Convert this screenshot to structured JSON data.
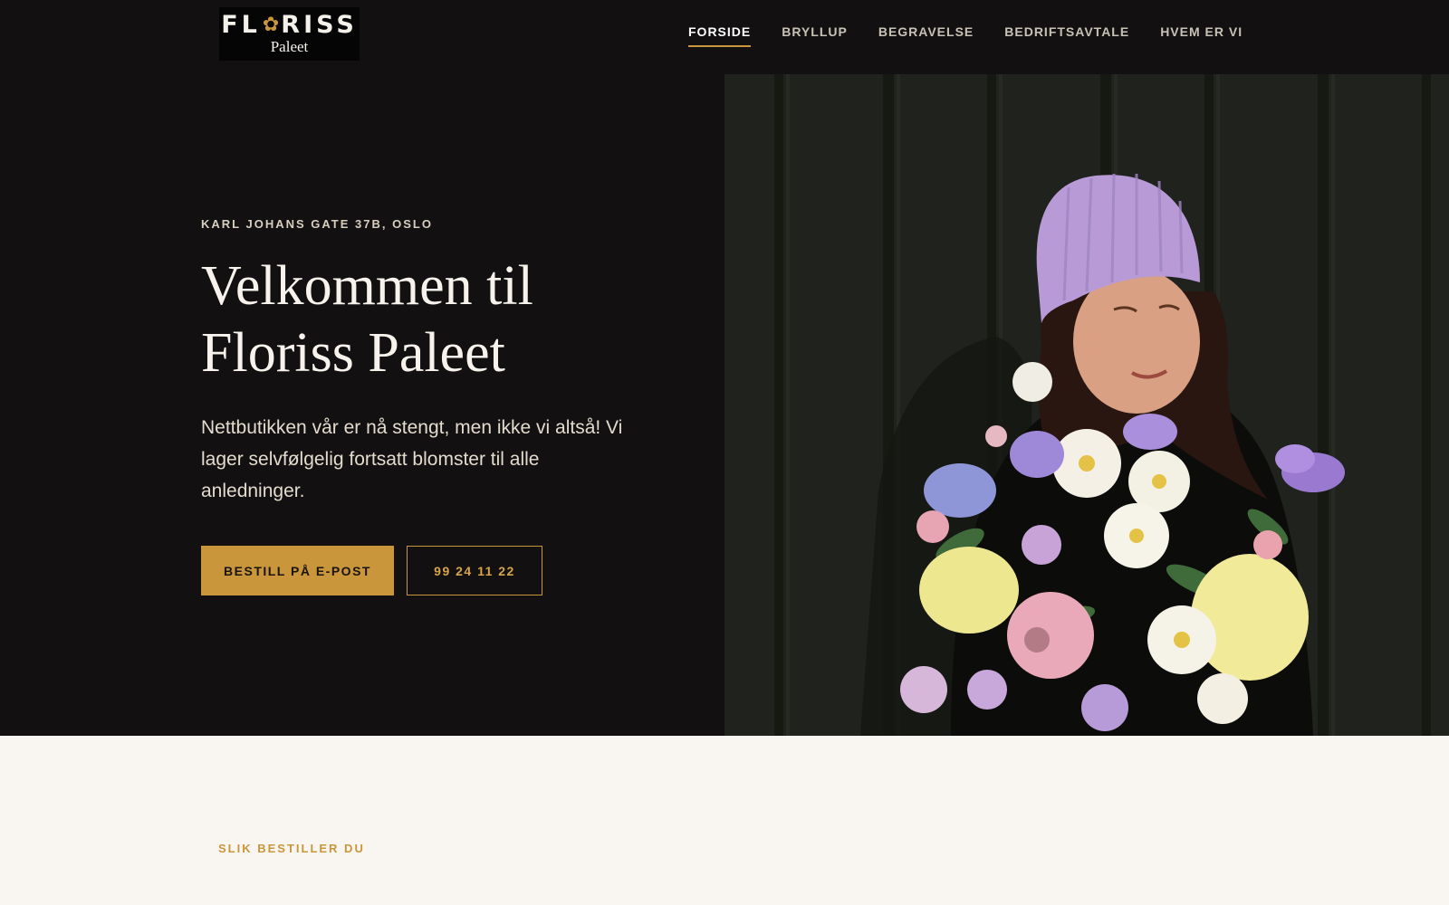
{
  "logo": {
    "main_left": "FL",
    "main_right": "RISS",
    "sub": "Paleet"
  },
  "nav": {
    "items": [
      {
        "label": "FORSIDE",
        "active": true
      },
      {
        "label": "BRYLLUP",
        "active": false
      },
      {
        "label": "BEGRAVELSE",
        "active": false
      },
      {
        "label": "BEDRIFTSAVTALE",
        "active": false
      },
      {
        "label": "HVEM ER VI",
        "active": false
      }
    ]
  },
  "hero": {
    "address": "KARL JOHANS GATE 37B, OSLO",
    "title_line1": "Velkommen til",
    "title_line2": "Floriss Paleet",
    "text": "Nettbutikken vår er nå stengt, men ikke vi altså! Vi lager selvfølgelig fortsatt blomster til alle anledninger.",
    "primary_button": "BESTILL PÅ E-POST",
    "secondary_button": "99 24 11 22"
  },
  "section2": {
    "eyebrow": "SLIK BESTILLER DU"
  },
  "colors": {
    "accent": "#c9963b",
    "dark_bg": "#121010",
    "light_bg": "#f9f6f1"
  }
}
